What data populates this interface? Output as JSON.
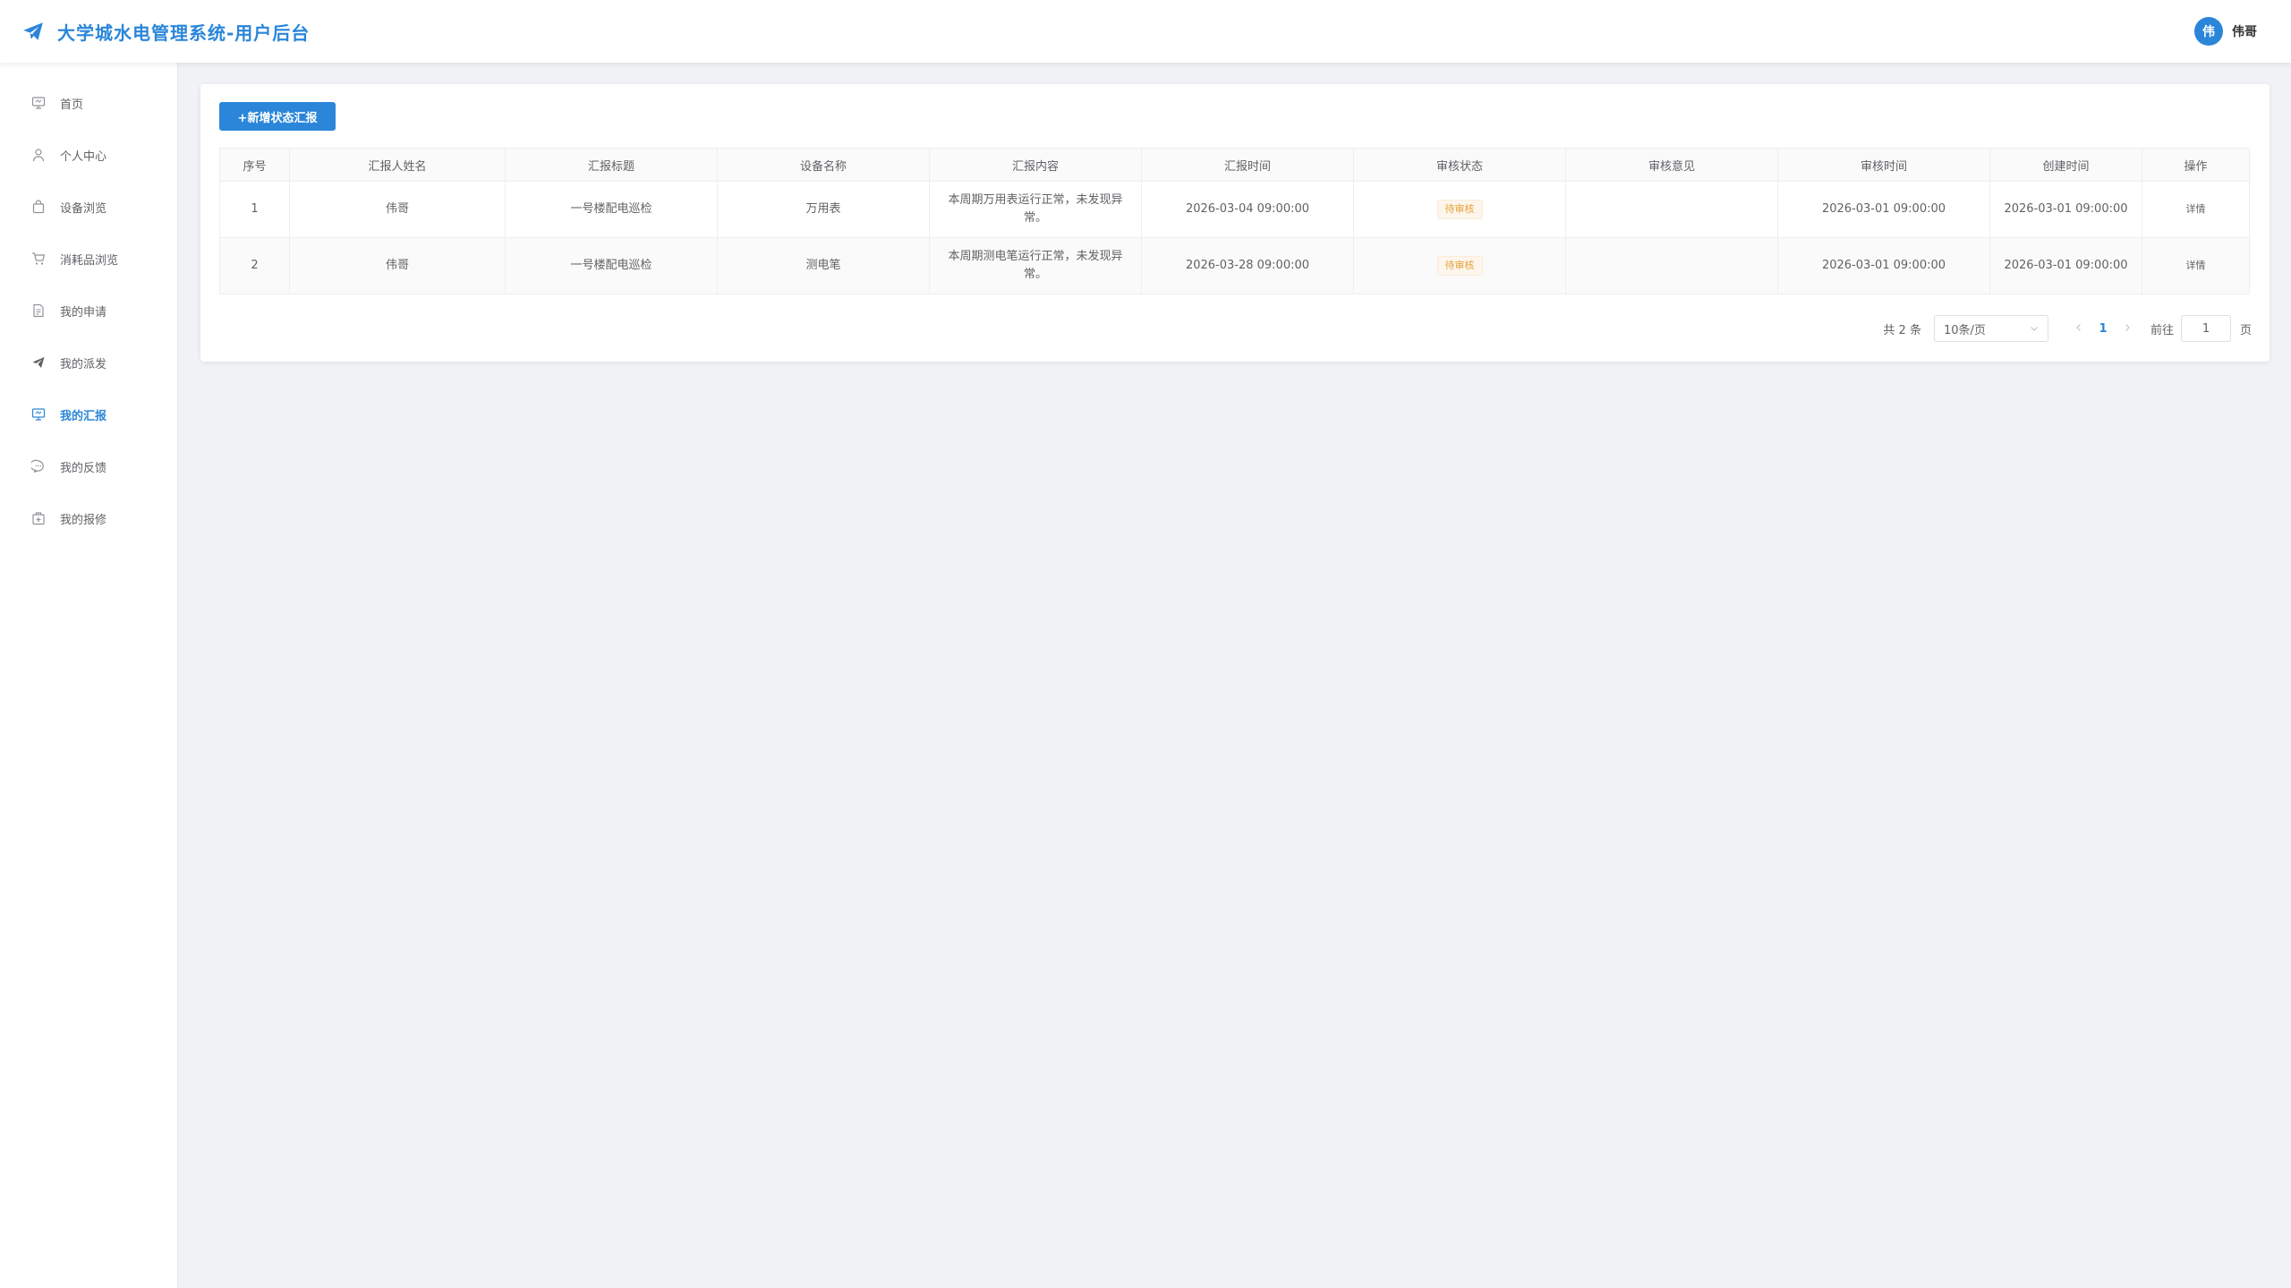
{
  "header": {
    "title": "大学城水电管理系统-用户后台",
    "user_avatar_text": "伟",
    "user_name": "伟哥",
    "accent_color": "#2b86d9"
  },
  "sidebar": {
    "items": [
      {
        "label": "首页",
        "icon": "monitor-icon"
      },
      {
        "label": "个人中心",
        "icon": "user-icon"
      },
      {
        "label": "设备浏览",
        "icon": "shopping-bag-icon"
      },
      {
        "label": "消耗品浏览",
        "icon": "cart-icon"
      },
      {
        "label": "我的申请",
        "icon": "document-icon"
      },
      {
        "label": "我的派发",
        "icon": "send-icon"
      },
      {
        "label": "我的汇报",
        "icon": "report-icon",
        "active": true
      },
      {
        "label": "我的反馈",
        "icon": "chat-icon"
      },
      {
        "label": "我的报修",
        "icon": "repair-box-icon"
      }
    ]
  },
  "toolbar": {
    "add_label": "+新增状态汇报"
  },
  "table": {
    "columns": [
      "序号",
      "汇报人姓名",
      "汇报标题",
      "设备名称",
      "汇报内容",
      "汇报时间",
      "审核状态",
      "审核意见",
      "审核时间",
      "创建时间",
      "操作"
    ],
    "rows": [
      {
        "index": "1",
        "reporter": "伟哥",
        "title": "一号楼配电巡检",
        "device": "万用表",
        "content": "本周期万用表运行正常，未发现异常。",
        "report_time": "2026-03-04 09:00:00",
        "status": "待审核",
        "opinion": "",
        "audit_time": "2026-03-01 09:00:00",
        "created_time": "2026-03-01 09:00:00",
        "action": "详情"
      },
      {
        "index": "2",
        "reporter": "伟哥",
        "title": "一号楼配电巡检",
        "device": "测电笔",
        "content": "本周期测电笔运行正常，未发现异常。",
        "report_time": "2026-03-28 09:00:00",
        "status": "待审核",
        "opinion": "",
        "audit_time": "2026-03-01 09:00:00",
        "created_time": "2026-03-01 09:00:00",
        "action": "详情"
      }
    ]
  },
  "pagination": {
    "total_text": "共 2 条",
    "page_size": "10条/页",
    "current_page": "1",
    "goto_label": "前往",
    "goto_value": "1",
    "unit_label": "页"
  }
}
